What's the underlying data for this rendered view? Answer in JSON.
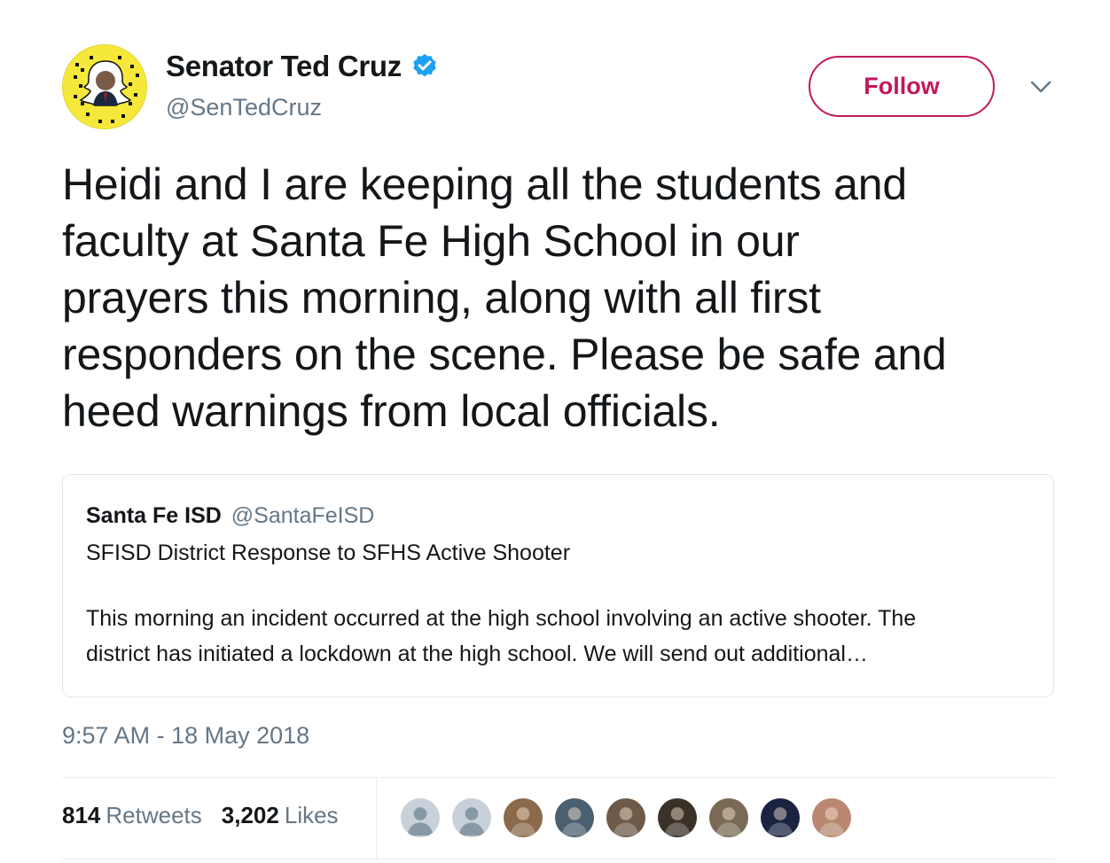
{
  "author": {
    "display_name": "Senator Ted Cruz",
    "handle": "@SenTedCruz",
    "verified_icon": "verified-badge-icon",
    "avatar_bg": "#f5e83a"
  },
  "follow": {
    "label": "Follow",
    "color": "#c2185b"
  },
  "caret_icon": "chevron-down-icon",
  "tweet": {
    "lines": [
      "Heidi and I are keeping all the students and",
      "faculty at Santa Fe High School in our",
      "prayers this morning, along with all first",
      "responders on the scene. Please be safe and",
      "heed warnings from local officials."
    ]
  },
  "quote": {
    "name": "Santa Fe ISD",
    "handle": "@SantaFeISD",
    "title": "SFISD District Response to SFHS Active Shooter",
    "body_lines": [
      "This morning an incident occurred at the high school involving an active shooter. The",
      "district has initiated a lockdown at the high school. We will send out additional…"
    ]
  },
  "timestamp": "9:57 AM - 18 May 2018",
  "stats": {
    "retweets_count": "814",
    "retweets_label": "Retweets",
    "likes_count": "3,202",
    "likes_label": "Likes"
  },
  "likers": [
    {
      "type": "default",
      "color": "#c8d1d9"
    },
    {
      "type": "default",
      "color": "#c8d1d9"
    },
    {
      "type": "photo",
      "color": "#8a6a4a"
    },
    {
      "type": "photo",
      "color": "#4a6070"
    },
    {
      "type": "photo",
      "color": "#6d5a48"
    },
    {
      "type": "photo",
      "color": "#3a3228"
    },
    {
      "type": "photo",
      "color": "#7a6a55"
    },
    {
      "type": "photo",
      "color": "#1a2440"
    },
    {
      "type": "photo",
      "color": "#b88870"
    }
  ]
}
